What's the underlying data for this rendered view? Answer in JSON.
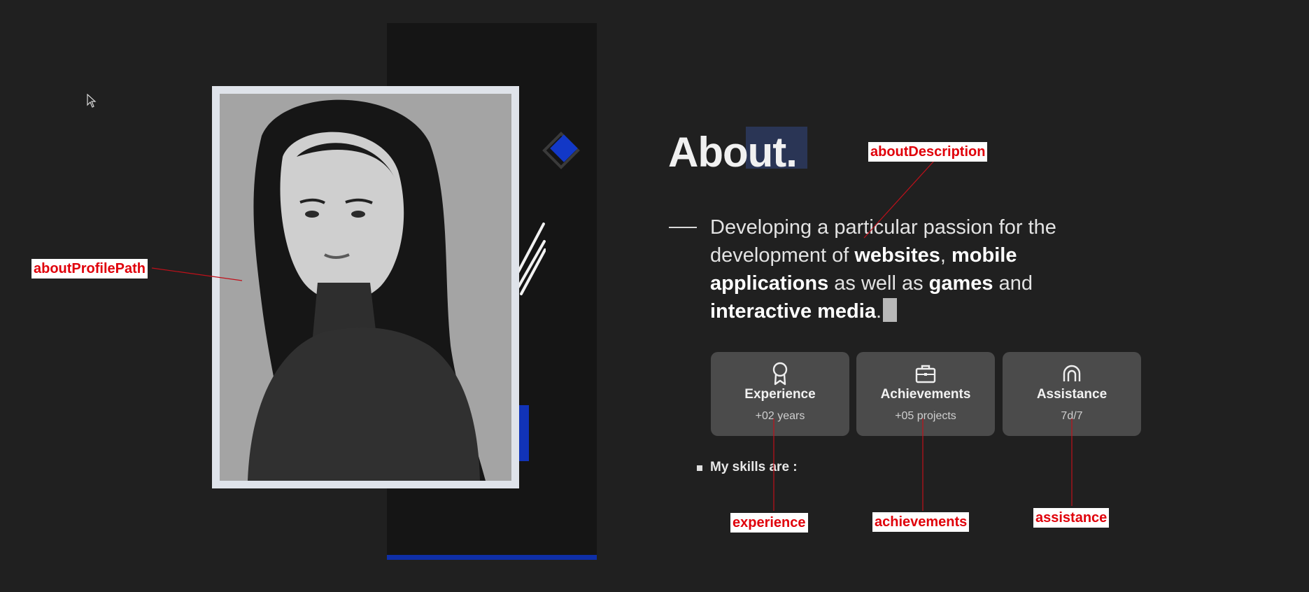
{
  "about": {
    "title": "About.",
    "description": {
      "p1": "Developing a particular passion for the development of ",
      "b1": "websites",
      "p2": ", ",
      "b2": "mobile applications",
      "p3": " as well as ",
      "b3": "games",
      "p4": " and ",
      "b4": "interactive media",
      "p5": "."
    },
    "cards": [
      {
        "icon": "award-icon",
        "title": "Experience",
        "value": "+02 years"
      },
      {
        "icon": "briefcase-icon",
        "title": "Achievements",
        "value": "+05 projects"
      },
      {
        "icon": "support-icon",
        "title": "Assistance",
        "value": "7d/7"
      }
    ],
    "skills_heading": "My skills are :"
  },
  "annotations": {
    "profile_path": "aboutProfilePath",
    "description": "aboutDescription",
    "experience": "experience",
    "achievements": "achievements",
    "assistance": "assistance"
  },
  "colors": {
    "background": "#202020",
    "panel": "#151515",
    "accent_blue": "#1238c7",
    "card": "#4b4b4b",
    "annotation_red": "#e0000a"
  }
}
